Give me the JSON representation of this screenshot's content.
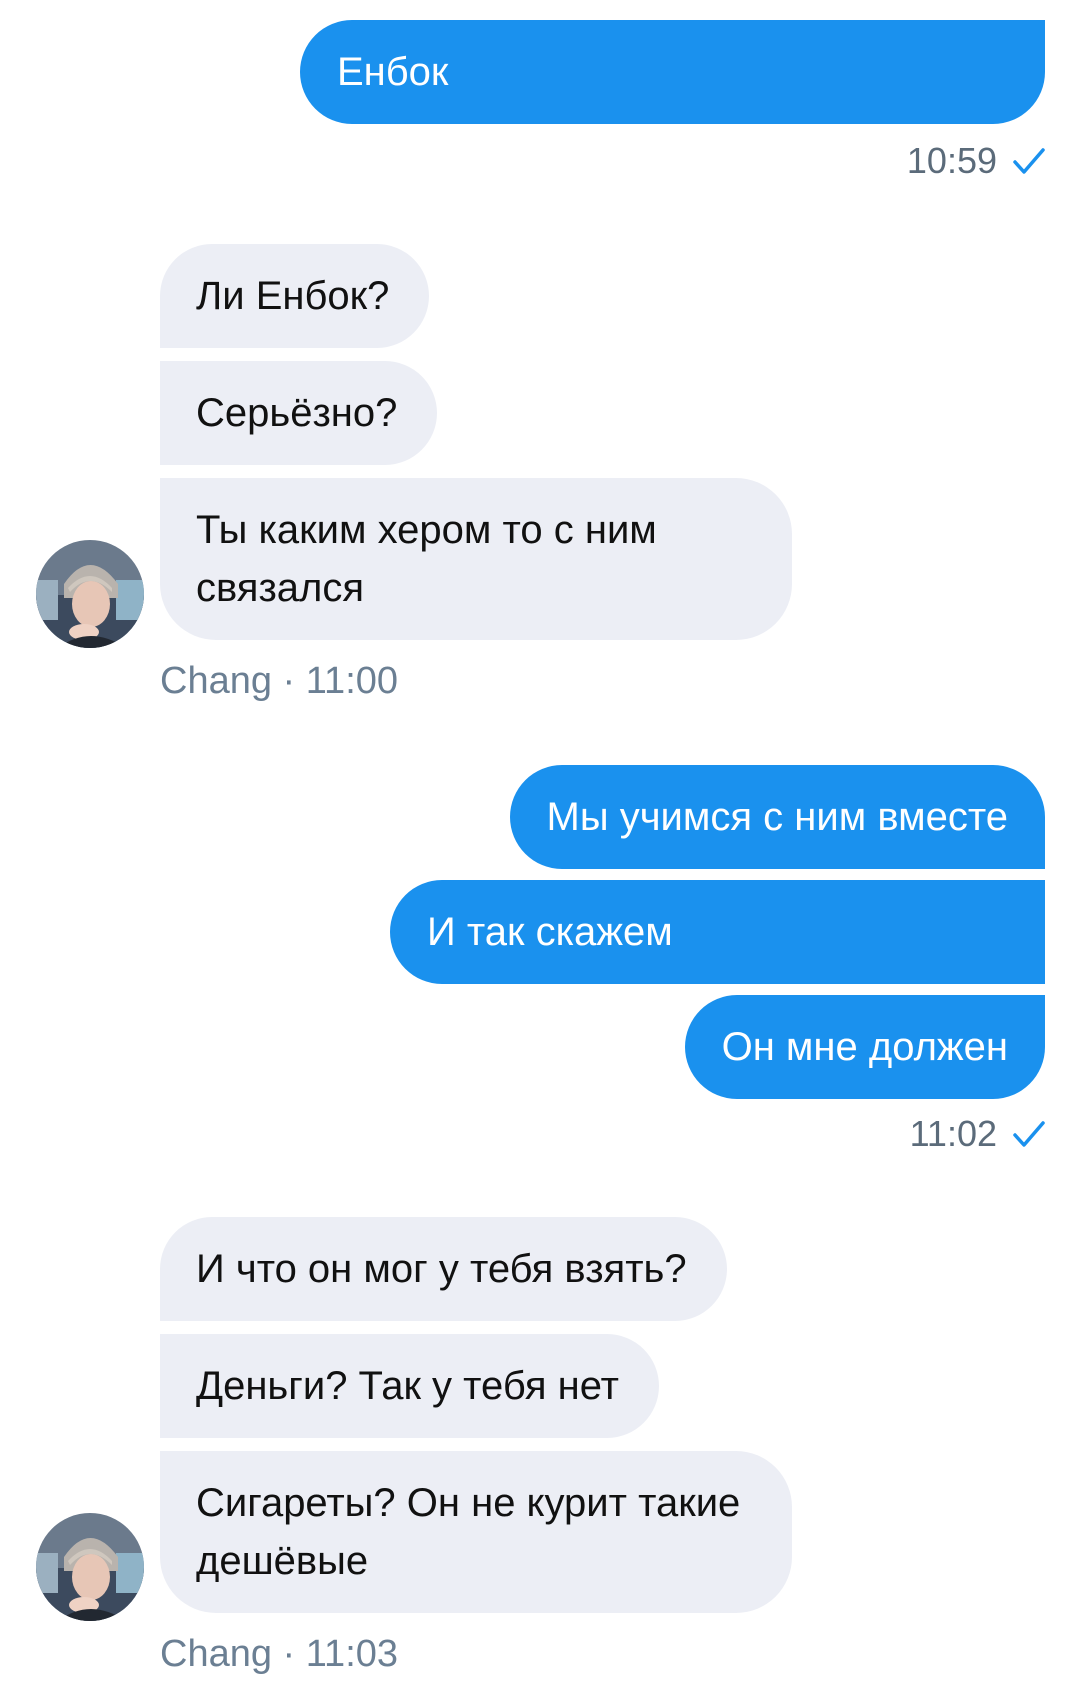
{
  "accent_color": "#1a91ee",
  "incoming_bubble_color": "#eceef5",
  "messages": [
    {
      "direction": "outgoing",
      "texts": [
        "Енбок"
      ],
      "time": "10:59",
      "status_icon": "check-icon"
    },
    {
      "direction": "incoming",
      "sender": "Chang",
      "texts": [
        "Ли Енбок?",
        "Серьёзно?",
        "Ты каким хером то с ним связался"
      ],
      "meta": "Chang · 11:00",
      "avatar_icon": "avatar"
    },
    {
      "direction": "outgoing",
      "texts": [
        "Мы учимся с ним вместе",
        "И так скажем",
        "Он мне должен"
      ],
      "time": "11:02",
      "status_icon": "check-icon"
    },
    {
      "direction": "incoming",
      "sender": "Chang",
      "texts": [
        "И что он мог у тебя взять?",
        "Деньги? Так у тебя нет",
        "Сигареты? Он не курит такие дешёвые"
      ],
      "meta": "Chang · 11:03",
      "avatar_icon": "avatar"
    }
  ]
}
